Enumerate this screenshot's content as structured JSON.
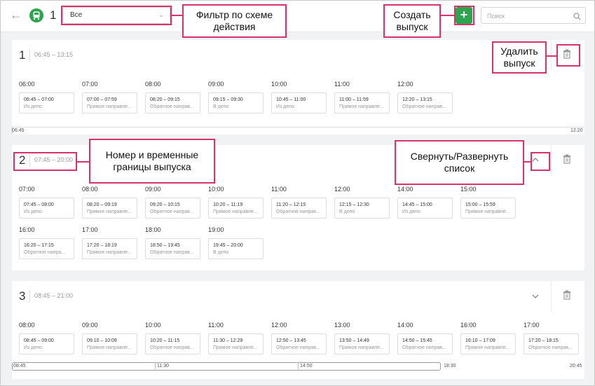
{
  "topbar": {
    "route_number": "1",
    "filter_value": "Все",
    "create_label": "+",
    "search_placeholder": "Поиск"
  },
  "releases": [
    {
      "num": "1",
      "range": "06:45 – 13:15",
      "rows": [
        [
          {
            "hour": "06:00",
            "time": "06:45 – 07:00",
            "dir": "Из депо"
          },
          {
            "hour": "07:00",
            "time": "07:00 – 07:59",
            "dir": "Прямое направле..."
          },
          {
            "hour": "08:00",
            "time": "08:20 – 09:15",
            "dir": "Обратное направ..."
          },
          {
            "hour": "09:00",
            "time": "09:15 – 09:30",
            "dir": "В депо"
          },
          {
            "hour": "10:00",
            "time": "10:45 – 11:00",
            "dir": "Из депо"
          },
          {
            "hour": "11:00",
            "time": "11:00 – 11:59",
            "dir": "Прямое направле..."
          },
          {
            "hour": "12:00",
            "time": "12:20 – 13:15",
            "dir": "Обратное направ..."
          }
        ]
      ],
      "timeline": {
        "start": "06:45",
        "end": "12:20"
      }
    },
    {
      "num": "2",
      "range": "07:45 – 20:00",
      "rows": [
        [
          {
            "hour": "07:00",
            "time": "07:45 – 08:00",
            "dir": "Из депо"
          },
          {
            "hour": "08:00",
            "time": "08:20 – 09:19",
            "dir": "Прямое направле..."
          },
          {
            "hour": "09:00",
            "time": "09:20 – 10:15",
            "dir": "Обратное направ..."
          },
          {
            "hour": "10:00",
            "time": "10:20 – 11:19",
            "dir": "Прямое направле..."
          },
          {
            "hour": "11:00",
            "time": "11:20 – 12:15",
            "dir": "Обратное направ..."
          },
          {
            "hour": "12:00",
            "time": "12:15 – 12:30",
            "dir": "В депо"
          },
          {
            "hour": "14:00",
            "time": "14:45 – 15:00",
            "dir": "Из депо"
          },
          {
            "hour": "15:00",
            "time": "15:00 – 15:59",
            "dir": "Прямое направле..."
          }
        ],
        [
          {
            "hour": "16:00",
            "time": "16:20 – 17:15",
            "dir": "Обратное напра..."
          },
          {
            "hour": "17:00",
            "time": "17:20 – 18:19",
            "dir": "Прямое направле..."
          },
          {
            "hour": "18:00",
            "time": "18:50 – 19:45",
            "dir": "Обратное направ..."
          },
          {
            "hour": "19:00",
            "time": "19:45 – 20:00",
            "dir": "В депо"
          }
        ]
      ]
    },
    {
      "num": "3",
      "range": "08:45 – 21:00",
      "rows": [
        [
          {
            "hour": "08:00",
            "time": "08:45 – 09:00",
            "dir": "Из депо"
          },
          {
            "hour": "09:00",
            "time": "09:10 – 10:09",
            "dir": "Прямое направле..."
          },
          {
            "hour": "10:00",
            "time": "10:20 – 11:15",
            "dir": "Обратное направ..."
          },
          {
            "hour": "11:00",
            "time": "11:30 – 12:29",
            "dir": "Прямое направле..."
          },
          {
            "hour": "12:00",
            "time": "12:50 – 13:45",
            "dir": "Обратное направ..."
          },
          {
            "hour": "13:00",
            "time": "13:50 – 14:49",
            "dir": "Прямое направле..."
          },
          {
            "hour": "14:00",
            "time": "14:50 – 15:45",
            "dir": "Обратное направ..."
          },
          {
            "hour": "16:00",
            "time": "16:10 – 17:09",
            "dir": "Прямое направле..."
          },
          {
            "hour": "17:00",
            "time": "17:20 – 18:15",
            "dir": "Обратное направ..."
          }
        ]
      ],
      "timeline": {
        "start": "08:45",
        "t2": "11:30",
        "t3": "14:50",
        "t4": "18:30",
        "end": "20:45"
      }
    }
  ],
  "callouts": {
    "filter": "Фильтр по схеме действия",
    "create": "Создать выпуск",
    "delete": "Удалить выпуск",
    "number": "Номер и временные границы выпуска",
    "collapse": "Свернуть/Развернуть список"
  },
  "colors": {
    "accent": "#2ea44f",
    "callout": "#d6336c"
  }
}
